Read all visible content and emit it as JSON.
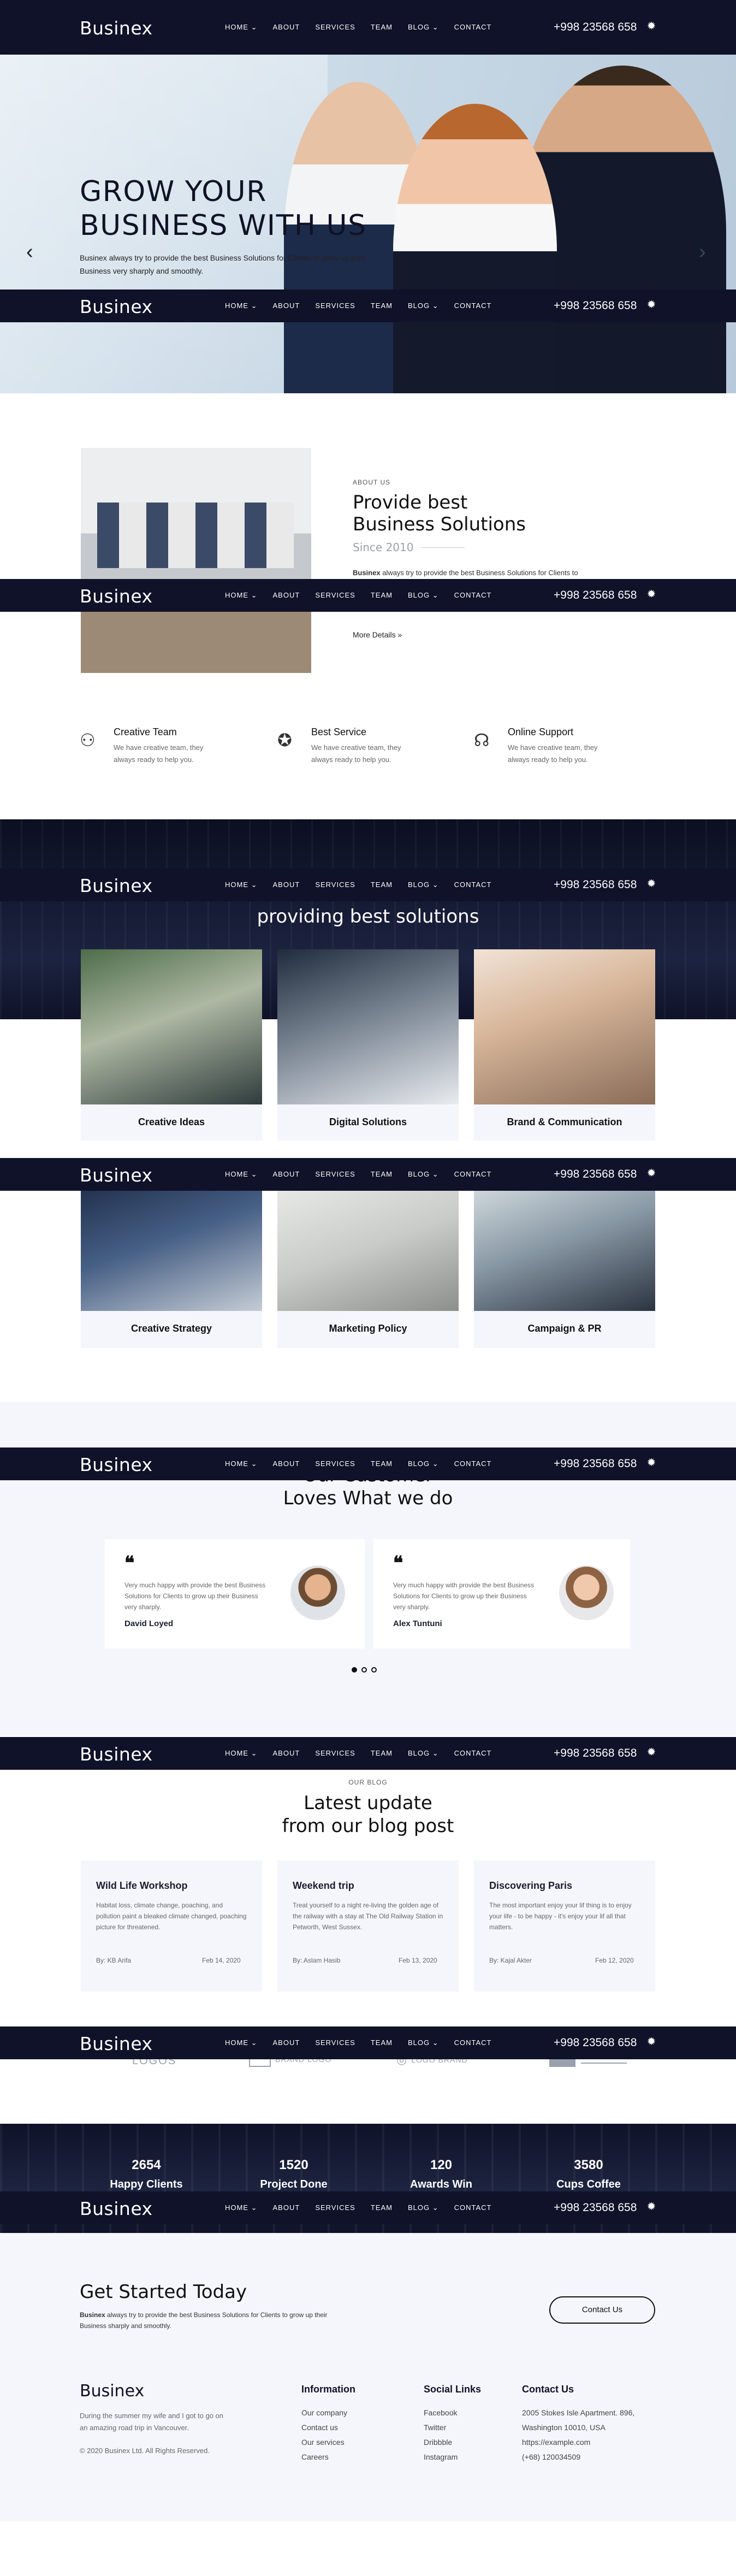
{
  "brand": {
    "logo": "Businex"
  },
  "nav": {
    "items": [
      "HOME ⌄",
      "ABOUT",
      "SERVICES",
      "TEAM",
      "BLOG ⌄",
      "CONTACT"
    ],
    "phone": "+998 23568 658",
    "settings_icon": "gear-icon"
  },
  "hero": {
    "title_line1": "GROW YOUR",
    "title_line2": "BUSINESS WITH US",
    "text": "Businex always try to provide the best Business Solutions for Clients to grow up their Business very sharply and smoothly.",
    "prev": "‹",
    "next": "›"
  },
  "about": {
    "label": "ABOUT US",
    "title_line1": "Provide best",
    "title_line2": "Business Solutions",
    "since": "Since 2010",
    "brand": "Businex",
    "text": " always try to provide the best Business Solutions for Clients to",
    "more": "More Details »"
  },
  "features": [
    {
      "title": "Creative Team",
      "text_line1": "We have creative team, they",
      "text_line2": "always ready to help you."
    },
    {
      "title": "Best Service",
      "text_line1": "We have creative team, they",
      "text_line2": "always ready to help you."
    },
    {
      "title": "Online Support",
      "text_line1": "We have creative team, they",
      "text_line2": "always ready to help you."
    }
  ],
  "services": {
    "title": "providing best solutions",
    "items": [
      "Creative Ideas",
      "Digital Solutions",
      "Brand & Communication",
      "Creative Strategy",
      "Marketing Policy",
      "Campaign & PR"
    ]
  },
  "testimonials": {
    "title_line1": "Our Customer",
    "title_line2": "Loves What we do",
    "items": [
      {
        "text": "Very much happy with provide the best Business Solutions for Clients to grow up their Business very sharply.",
        "name": "David Loyed"
      },
      {
        "text": "Very much happy with provide the best Business Solutions for Clients to grow up their Business very sharply.",
        "name": "Alex Tuntuni"
      }
    ]
  },
  "blog": {
    "label": "OUR BLOG",
    "title_line1": "Latest update",
    "title_line2": "from our blog post",
    "posts": [
      {
        "title": "Wild Life Workshop",
        "text": "Habitat loss, climate change, poaching, and pollution paint a bleaked climate changed, poaching picture for threatened.",
        "author": "By: KB Arifa",
        "date": "Feb 14, 2020"
      },
      {
        "title": "Weekend trip",
        "text": "Treat yourself to a night re-living the golden age of the railway with a stay at The Old Railway Station in Petworth, West Sussex.",
        "author": "By: Aslam Hasib",
        "date": "Feb 13, 2020"
      },
      {
        "title": "Discovering Paris",
        "text": "The most important enjoy your lif thing is to enjoy your life - to be happy - it's enjoy your lif all that matters.",
        "author": "By: Kajal Akter",
        "date": "Feb 12, 2020"
      }
    ]
  },
  "logos": [
    "LOGOS",
    "BRAND LOGO",
    "LOGO BRAND"
  ],
  "stats": [
    {
      "value": "2654",
      "label": "Happy Clients"
    },
    {
      "value": "1520",
      "label": "Project Done"
    },
    {
      "value": "120",
      "label": "Awards Win"
    },
    {
      "value": "3580",
      "label": "Cups Coffee"
    }
  ],
  "cta": {
    "title": "Get Started Today",
    "brand": "Businex",
    "text": " always try to provide the best Business Solutions for Clients to grow up their Business sharply and smoothly.",
    "button": "Contact Us"
  },
  "footer": {
    "about_line1": "During the summer my wife and I got to go on",
    "about_line2": "an amazing road trip in Vancouver.",
    "copyright": "© 2020 Businex Ltd. All Rights Reserved.",
    "info_title": "Information",
    "info_links": [
      "Our company",
      "Contact us",
      "Our services",
      "Careers"
    ],
    "social_title": "Social Links",
    "social_links": [
      "Facebook",
      "Twitter",
      "Dribbble",
      "Instagram"
    ],
    "contact_title": "Contact Us",
    "contact_lines": [
      "2005 Stokes Isle Apartment. 896,",
      "Washington 10010, USA",
      "https://example.com",
      "(+68) 120034509"
    ]
  },
  "colors": {
    "navy": "#0f1228",
    "light_bg": "#f5f6fc",
    "white": "#ffffff"
  }
}
